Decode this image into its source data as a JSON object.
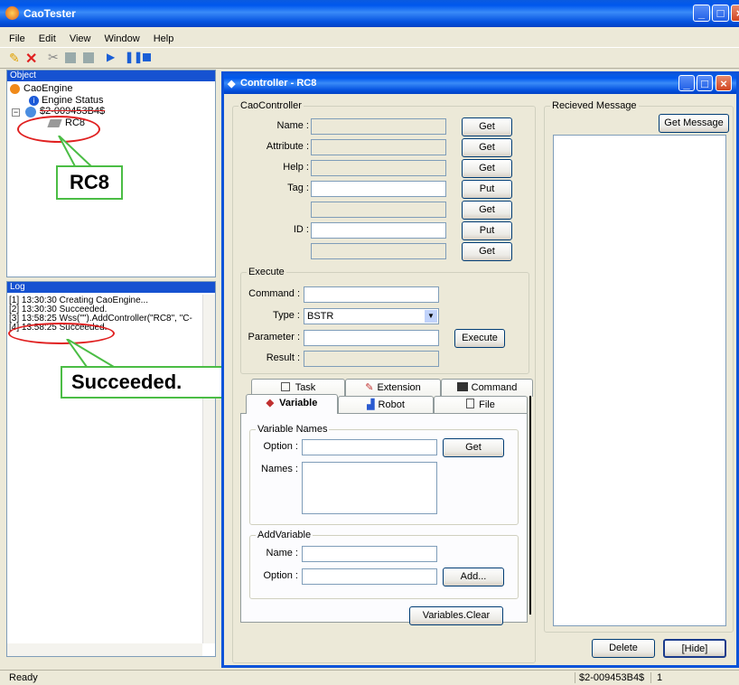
{
  "app": {
    "title": "CaoTester"
  },
  "menu": [
    "File",
    "Edit",
    "View",
    "Window",
    "Help"
  ],
  "object_pane": {
    "title": "Object",
    "root": "CaoEngine",
    "engine_status": "Engine Status",
    "workspace": "$2-009453B4$",
    "controller": "RC8"
  },
  "callouts": {
    "rc8": "RC8",
    "succeeded": "Succeeded."
  },
  "log_pane": {
    "title": "Log",
    "lines": [
      "[1] 13:30:30 Creating CaoEngine...",
      "[2] 13:30:30 Succeeded.",
      "[3] 13:58:25 Wss(\"\").AddController(\"RC8\", \"C-",
      "[4] 13:58:25 Succeeded."
    ]
  },
  "controller_window": {
    "title": "Controller - RC8"
  },
  "cao_controller": {
    "caption": "CaoController",
    "name": "Name :",
    "attribute": "Attribute :",
    "help": "Help :",
    "tag": "Tag :",
    "id": "ID :",
    "get": "Get",
    "put": "Put"
  },
  "execute": {
    "caption": "Execute",
    "command": "Command :",
    "type": "Type :",
    "type_value": "BSTR",
    "parameter": "Parameter :",
    "result": "Result :",
    "execute_btn": "Execute"
  },
  "tabs": {
    "task": "Task",
    "extension": "Extension",
    "command": "Command",
    "variable": "Variable",
    "robot": "Robot",
    "file": "File"
  },
  "variable_names": {
    "caption": "Variable Names",
    "option": "Option :",
    "names": "Names :",
    "get": "Get"
  },
  "add_variable": {
    "caption": "AddVariable",
    "name": "Name :",
    "option": "Option :",
    "add": "Add..."
  },
  "variables_clear": "Variables.Clear",
  "received": {
    "caption": "Recieved Message",
    "get_message": "Get Message",
    "delete": "Delete",
    "hide": "[Hide]"
  },
  "status": {
    "ready": "Ready",
    "workspace": "$2-009453B4$",
    "count": "1"
  }
}
